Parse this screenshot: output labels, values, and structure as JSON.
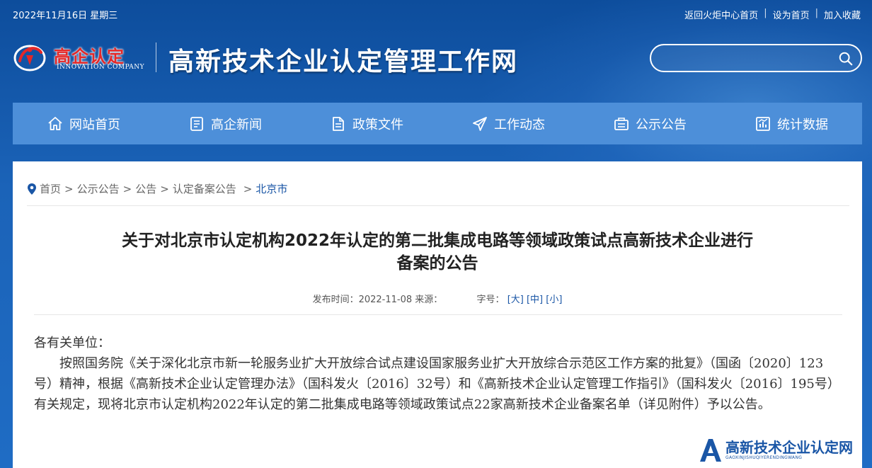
{
  "topbar": {
    "date": "2022年11月16日 星期三",
    "links": [
      "返回火炬中心首页",
      "设为首页",
      "加入收藏"
    ]
  },
  "logo": {
    "cn": "高企认定",
    "en": "INNOVATION COMPANY"
  },
  "site_title": "高新技术企业认定管理工作网",
  "search": {
    "placeholder": ""
  },
  "nav": {
    "items": [
      {
        "label": "网站首页",
        "icon": "home-icon"
      },
      {
        "label": "高企新闻",
        "icon": "news-icon"
      },
      {
        "label": "政策文件",
        "icon": "document-icon"
      },
      {
        "label": "工作动态",
        "icon": "paper-plane-icon"
      },
      {
        "label": "公示公告",
        "icon": "notice-icon"
      },
      {
        "label": "统计数据",
        "icon": "chart-icon"
      }
    ]
  },
  "breadcrumb": [
    "首页",
    "公示公告",
    "公告",
    "认定备案公告",
    "北京市"
  ],
  "article": {
    "title_line1": "关于对北京市认定机构2022年认定的第二批集成电路等领域政策试点高新技术企业进行",
    "title_line2": "备案的公告",
    "meta_published": "发布时间：2022-11-08 来源：",
    "meta_fontsize": "字号：",
    "font_sizes": [
      "[大]",
      "[中]",
      "[小]"
    ],
    "salutation": "各有关单位：",
    "paragraph": "按照国务院《关于深化北京市新一轮服务业扩大开放综合试点建设国家服务业扩大开放综合示范区工作方案的批复》（国函〔2020〕123号）精神，根据《高新技术企业认定管理办法》（国科发火〔2016〕32号）和《高新技术企业认定管理工作指引》（国科发火〔2016〕195号）有关规定，现将北京市认定机构2022年认定的第二批集成电路等领域政策试点22家高新技术企业备案名单（详见附件）予以公告。"
  },
  "watermark": {
    "cn": "高新技术企业认定网",
    "en": "GAOXINJISHUQIYERENDINGWANG"
  },
  "colors": {
    "nav_bg": "#4d8fd9",
    "page_bg": "#1b63b8",
    "logo_red": "#e42828",
    "link_blue": "#1a56a6"
  }
}
